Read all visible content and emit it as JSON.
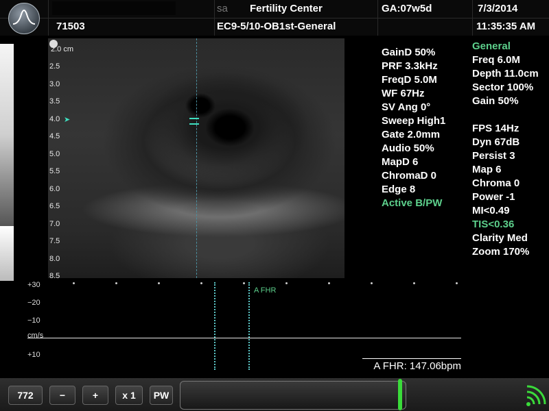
{
  "header": {
    "patient_name": "",
    "patient_id": "71503",
    "institution": "Fertility Center",
    "institution_prefix": "sa",
    "exam_preset": "EC9-5/10-OB1st-General",
    "gestational_age": "GA:07w5d",
    "date": "7/3/2014",
    "time": "11:35:35 AM"
  },
  "depth_scale": {
    "unit_label": "2.0 cm",
    "ticks": [
      "2.5",
      "3.0",
      "3.5",
      "4.0",
      "4.5",
      "5.0",
      "5.5",
      "6.0",
      "6.5",
      "7.0",
      "7.5",
      "8.0",
      "8.5"
    ],
    "marker_depth": "4.0",
    "marker_glyph": "➤"
  },
  "doppler_params": {
    "items": [
      {
        "text": "GainD 50%"
      },
      {
        "text": "PRF 3.3kHz"
      },
      {
        "text": "FreqD 5.0M"
      },
      {
        "text": "WF 67Hz"
      },
      {
        "text": "SV Ang 0°"
      },
      {
        "text": "Sweep High1"
      },
      {
        "text": "Gate 2.0mm"
      },
      {
        "text": "Audio 50%"
      },
      {
        "text": "MapD 6"
      },
      {
        "text": "ChromaD 0"
      },
      {
        "text": "Edge 8"
      },
      {
        "text": "Active B/PW"
      }
    ]
  },
  "image_params": {
    "group1": [
      {
        "text": "General"
      },
      {
        "text": "Freq 6.0M"
      },
      {
        "text": "Depth 11.0cm"
      },
      {
        "text": "Sector 100%"
      },
      {
        "text": "Gain 50%"
      }
    ],
    "group2": [
      {
        "text": "FPS 14Hz"
      },
      {
        "text": "Dyn 67dB"
      },
      {
        "text": "Persist 3"
      },
      {
        "text": "Map 6"
      },
      {
        "text": "Chroma 0"
      },
      {
        "text": "Power -1"
      },
      {
        "text": "MI<0.49"
      },
      {
        "text": "TIS<0.36"
      },
      {
        "text": "Clarity Med"
      },
      {
        "text": "Zoom 170%"
      }
    ]
  },
  "doppler_scale": {
    "labels": [
      "+30",
      "−20",
      "−10",
      "cm/s",
      "+10"
    ],
    "marker_label": "A FHR"
  },
  "measurement": {
    "fhr_readout": "A FHR: 147.06bpm"
  },
  "toolbar": {
    "frame_count": "772",
    "minus": "−",
    "plus": "+",
    "speed": "x 1",
    "mode": "PW"
  },
  "colors": {
    "accent_green": "#5dd08c",
    "marker_cyan": "#3ee0c0",
    "cine_handle": "#3adb3a"
  },
  "icons": [
    "logo-icon",
    "wifi-signal-icon"
  ]
}
